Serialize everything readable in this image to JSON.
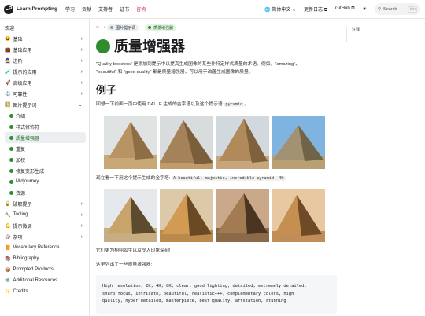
{
  "topbar": {
    "brand": "Learn Prompting",
    "nav": [
      {
        "label": "学习",
        "active": false
      },
      {
        "label": "贡献",
        "active": false
      },
      {
        "label": "支持者",
        "active": false
      },
      {
        "label": "证书",
        "active": false
      },
      {
        "label": "咨询",
        "active": true
      }
    ],
    "lang": "🌐 简体中文 ⌄",
    "changelog": "更新日志 ⧉",
    "github": "GitHub ⧉",
    "search_label": "Search",
    "search_kbd": "⌘K"
  },
  "sidebar": {
    "items": [
      {
        "label": "欢迎",
        "icon": "",
        "chevron": false
      },
      {
        "label": "基础",
        "icon": "😀",
        "chevron": true
      },
      {
        "label": "基础应用",
        "icon": "💼",
        "chevron": true
      },
      {
        "label": "进阶",
        "icon": "🧙",
        "chevron": true
      },
      {
        "label": "提示的应用",
        "icon": "🧪",
        "chevron": true
      },
      {
        "label": "高级应用",
        "icon": "🚀",
        "chevron": true
      },
      {
        "label": "可靠性",
        "icon": "⚖️",
        "chevron": true
      },
      {
        "label": "图片提示词",
        "icon": "🖼️",
        "chevron": true
      }
    ],
    "sub_items": [
      {
        "label": "介绍",
        "selected": false
      },
      {
        "label": "样式修饰符",
        "selected": false
      },
      {
        "label": "质量增强器",
        "selected": true
      },
      {
        "label": "重复",
        "selected": false
      },
      {
        "label": "加权",
        "selected": false
      },
      {
        "label": "修复变形生成",
        "selected": false
      },
      {
        "label": "Midjourney",
        "selected": false
      },
      {
        "label": "资源",
        "selected": false
      }
    ],
    "items_after": [
      {
        "label": "破解提示",
        "icon": "🔓",
        "chevron": true
      },
      {
        "label": "Tooling",
        "icon": "🔨",
        "chevron": true
      },
      {
        "label": "提示微调",
        "icon": "💪",
        "chevron": true
      },
      {
        "label": "杂项",
        "icon": "🎲",
        "chevron": true
      },
      {
        "label": "Vocabulary Reference",
        "icon": "📙",
        "chevron": false
      },
      {
        "label": "Bibliography",
        "icon": "📚",
        "chevron": false
      },
      {
        "label": "Prompted Products",
        "icon": "📦",
        "chevron": false
      },
      {
        "label": "Additional Resources",
        "icon": "🛸",
        "chevron": false
      },
      {
        "label": "Credits",
        "icon": "✨",
        "chevron": false
      }
    ]
  },
  "main": {
    "crumbs": [
      "图片提示词",
      "质量增强器"
    ],
    "title": "质量增强器",
    "intro_1": "\"Quality boosters\" 是添加到提示中以提高生成图像的某些非特定样式质量的术语。例如，\"amazing\"、",
    "intro_2": "\"beautiful\" 和 \"good quality\" 都是质量增强器，可以用于改善生成图像的质量。",
    "h2": "例子",
    "recall_text": "回想一下前面一页中使用 DALLE 生成的金字塔以及这个提示语",
    "recall_code": "pyramid",
    "recall_end": "。",
    "now_text": "现在看一下用这个提示生成的金字塔:",
    "now_code": "A beautiful, majestic, incredible pyramid, 4K",
    "impress_text": "它们更为栩栩如生以及令人印象深刻!",
    "list_text": "这里列出了一些质量增强器:",
    "codeblock": [
      "High resolution, 2K, 4K, 8K, clear, good lighting, detailed, extremely detailed,",
      "sharp focus, intricate, beautiful, realistic+++, complementary colors, high",
      "quality, hyper detailed, masterpiece, best quality, artstation, stunning"
    ]
  },
  "toc": {
    "label": "注释"
  }
}
